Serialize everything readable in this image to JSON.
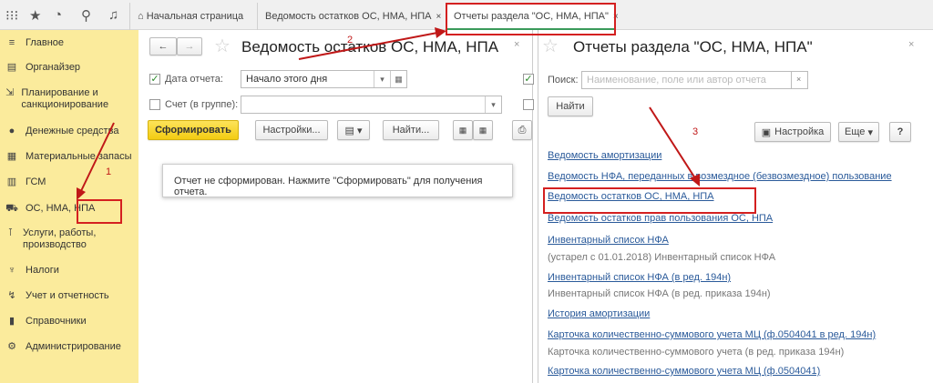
{
  "toolbar": {
    "icons": [
      "apps-grid-icon",
      "star-icon",
      "history-icon",
      "search-icon",
      "bell-icon"
    ]
  },
  "tabs": [
    {
      "label": "Начальная страница",
      "icon": "home-icon"
    },
    {
      "label": "Ведомость остатков ОС, НМА, НПА",
      "close": "×"
    },
    {
      "label": "Отчеты раздела \"ОС, НМА, НПА\"",
      "close": "×",
      "active": true
    }
  ],
  "sidebar": {
    "items": [
      {
        "label": "Главное",
        "icon": "≡"
      },
      {
        "label": "Органайзер",
        "icon": "▤"
      },
      {
        "label": "Планирование и санкционирование",
        "icon": "⇲"
      },
      {
        "label": "Денежные средства",
        "icon": "●"
      },
      {
        "label": "Материальные запасы",
        "icon": "▦"
      },
      {
        "label": "ГСМ",
        "icon": "▥"
      },
      {
        "label": "ОС, НМА, НПА",
        "icon": "⛟"
      },
      {
        "label": "Услуги, работы, производство",
        "icon": "⊺"
      },
      {
        "label": "Налоги",
        "icon": "♆"
      },
      {
        "label": "Учет и отчетность",
        "icon": "↯"
      },
      {
        "label": "Справочники",
        "icon": "▮"
      },
      {
        "label": "Администрирование",
        "icon": "⚙"
      }
    ]
  },
  "report": {
    "title": "Ведомость остатков ОС, НМА, НПА",
    "date_label": "Дата отчета:",
    "date_value": "Начало этого дня",
    "account_label": "Счет (в группе):",
    "account_value": "",
    "generate": "Сформировать",
    "settings": "Настройки...",
    "find": "Найти...",
    "message": "Отчет не сформирован. Нажмите \"Сформировать\" для получения отчета."
  },
  "reports_panel": {
    "title": "Отчеты раздела \"ОС, НМА, НПА\"",
    "search_label": "Поиск:",
    "search_placeholder": "Наименование, поле или автор отчета",
    "find": "Найти",
    "setup": "Настройка",
    "more": "Еще",
    "help": "?",
    "items": [
      {
        "text": "Ведомость амортизации",
        "type": "link"
      },
      {
        "text": "Ведомость НФА, переданных в возмездное (безвозмездное) пользование",
        "type": "link"
      },
      {
        "text": "Ведомость остатков ОС, НМА, НПА",
        "type": "link"
      },
      {
        "text": "Ведомость остатков прав пользования ОС, НПА",
        "type": "link"
      },
      {
        "text": "Инвентарный список НФА",
        "type": "link"
      },
      {
        "text": "(устарел с 01.01.2018) Инвентарный список НФА",
        "type": "note"
      },
      {
        "text": "Инвентарный список НФА (в ред. 194н)",
        "type": "link"
      },
      {
        "text": "Инвентарный список НФА (в ред. приказа 194н)",
        "type": "note"
      },
      {
        "text": "История амортизации",
        "type": "link"
      },
      {
        "text": "Карточка количественно-суммового учета МЦ  (ф.0504041 в ред. 194н)",
        "type": "link"
      },
      {
        "text": "Карточка количественно-суммового учета (в ред. приказа 194н)",
        "type": "note"
      },
      {
        "text": "Карточка количественно-суммового учета МЦ  (ф.0504041)",
        "type": "link"
      }
    ]
  },
  "annotations": {
    "step1": "1",
    "step2": "2",
    "step3": "3",
    "color": "#d42020"
  }
}
